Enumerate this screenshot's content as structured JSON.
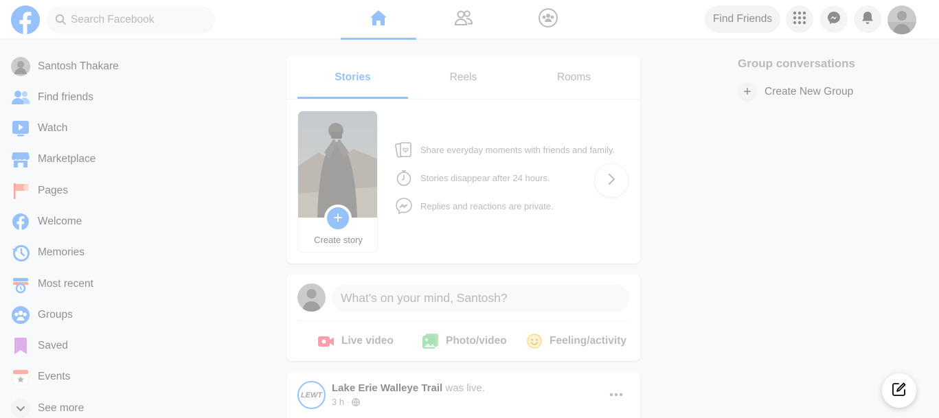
{
  "header": {
    "search_placeholder": "Search Facebook",
    "find_friends_label": "Find Friends",
    "nav_tabs": [
      "home",
      "friends",
      "groups"
    ],
    "icons": {
      "logo": "facebook-logo",
      "search": "search-icon",
      "home": "home-icon",
      "friends": "friends-icon",
      "groups": "groups-icon",
      "menu": "grid-menu-icon",
      "messenger": "messenger-icon",
      "notifications": "bell-icon"
    }
  },
  "sidebar": {
    "items": [
      {
        "label": "Santosh Thakare",
        "icon": "profile-avatar"
      },
      {
        "label": "Find friends",
        "icon": "friends-icon"
      },
      {
        "label": "Watch",
        "icon": "watch-icon"
      },
      {
        "label": "Marketplace",
        "icon": "marketplace-icon"
      },
      {
        "label": "Pages",
        "icon": "pages-flag-icon"
      },
      {
        "label": "Welcome",
        "icon": "facebook-icon"
      },
      {
        "label": "Memories",
        "icon": "memories-clock-icon"
      },
      {
        "label": "Most recent",
        "icon": "most-recent-icon"
      },
      {
        "label": "Groups",
        "icon": "groups-icon"
      },
      {
        "label": "Saved",
        "icon": "saved-bookmark-icon"
      },
      {
        "label": "Events",
        "icon": "events-calendar-icon"
      },
      {
        "label": "See more",
        "icon": "chevron-down-icon"
      }
    ]
  },
  "stories": {
    "tabs": [
      "Stories",
      "Reels",
      "Rooms"
    ],
    "active_tab": "Stories",
    "create_story_label": "Create story",
    "info": [
      {
        "text": "Share everyday moments with friends and family.",
        "icon": "story-cards-icon"
      },
      {
        "text": "Stories disappear after 24 hours.",
        "icon": "stopwatch-icon"
      },
      {
        "text": "Replies and reactions are private.",
        "icon": "messenger-icon"
      }
    ]
  },
  "composer": {
    "placeholder": "What's on your mind, Santosh?",
    "actions": [
      {
        "label": "Live video",
        "icon": "live-video-icon",
        "color": "#f02849"
      },
      {
        "label": "Photo/video",
        "icon": "photo-icon",
        "color": "#45bd62"
      },
      {
        "label": "Feeling/activity",
        "icon": "feeling-icon",
        "color": "#f7b928"
      }
    ]
  },
  "post": {
    "page_name": "Lake Erie Walleye Trail",
    "action_text": "was live.",
    "time": "3 h ·",
    "avatar_text": "LEWT"
  },
  "right_rail": {
    "title": "Group conversations",
    "create_group_label": "Create New Group"
  },
  "colors": {
    "brand": "#1877f2",
    "background": "#f0f2f5",
    "text_secondary": "#65676b"
  }
}
